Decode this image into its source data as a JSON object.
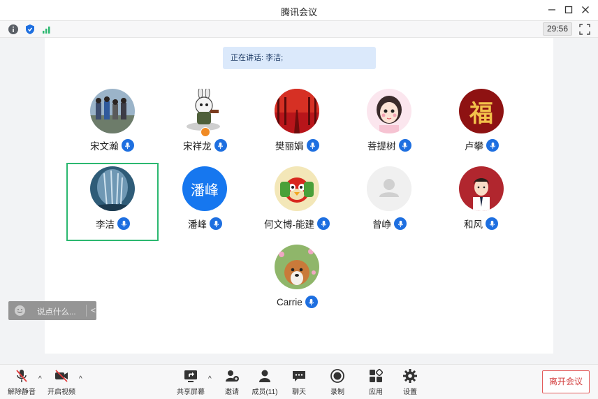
{
  "window": {
    "title": "腾讯会议"
  },
  "infobar": {
    "timer": "29:56"
  },
  "speaking": {
    "text": "正在讲话: 李洁;"
  },
  "participants": [
    {
      "name": "宋文瀚",
      "avatar": "group-photo"
    },
    {
      "name": "宋祥龙",
      "avatar": "cartoon-rabbit"
    },
    {
      "name": "樊丽娟",
      "avatar": "red-trees"
    },
    {
      "name": "菩提树",
      "avatar": "cartoon-girl"
    },
    {
      "name": "卢攀",
      "avatar": "fu-character",
      "avatar_text": "福"
    },
    {
      "name": "李洁",
      "avatar": "ice-waterfall"
    },
    {
      "name": "潘峰",
      "avatar": "text-initials",
      "avatar_text": "潘峰"
    },
    {
      "name": "何文博-能建",
      "avatar": "cartoon-bird"
    },
    {
      "name": "曾峥",
      "avatar": "default-person"
    },
    {
      "name": "和风",
      "avatar": "cartoon-man"
    },
    {
      "name": "Carrie",
      "avatar": "dog-photo"
    }
  ],
  "chat": {
    "placeholder": "说点什么..."
  },
  "toolbar": {
    "unmute": "解除静音",
    "start_video": "开启视频",
    "share_screen": "共享屏幕",
    "invite": "邀请",
    "members": "成员(11)",
    "chat": "聊天",
    "record": "录制",
    "apps": "应用",
    "settings": "设置",
    "leave": "离开会议"
  },
  "colors": {
    "accent": "#1e6fe0",
    "active_border": "#2bb870",
    "leave": "#d23b3b"
  }
}
